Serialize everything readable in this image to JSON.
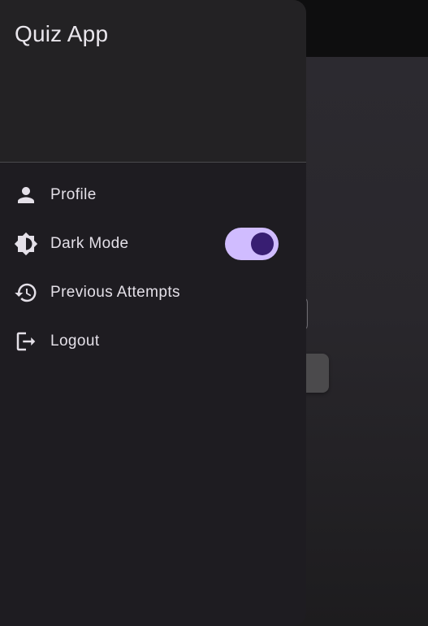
{
  "drawer": {
    "title": "Quiz App",
    "items": [
      {
        "label": "Profile",
        "icon": "person-icon"
      },
      {
        "label": "Dark Mode",
        "icon": "brightness-icon",
        "toggle_on": true
      },
      {
        "label": "Previous Attempts",
        "icon": "history-icon"
      },
      {
        "label": "Logout",
        "icon": "logout-icon"
      }
    ]
  },
  "colors": {
    "drawer_bg": "#1e1c21",
    "header_bg": "#232224",
    "toggle_track": "#d0bcff",
    "toggle_thumb": "#381e72",
    "text": "#e4e0e8"
  }
}
